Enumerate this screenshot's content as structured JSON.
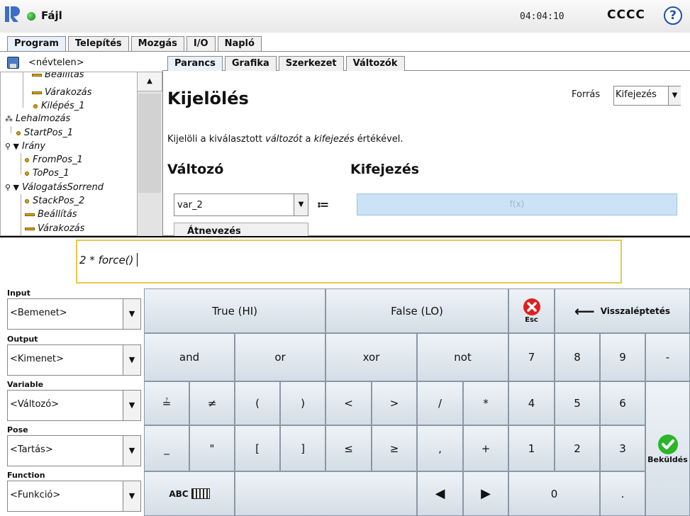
{
  "topbar": {
    "file_menu": "Fájl",
    "clock": "04:04:10",
    "robot_name": "CCCC",
    "help": "?"
  },
  "main_tabs": [
    "Program",
    "Telepítés",
    "Mozgás",
    "I/O",
    "Napló"
  ],
  "file": {
    "name": "<névtelen>"
  },
  "tree": [
    "Beállítás",
    "Várakozás",
    "Kilépés_1",
    "Lehalmozás",
    "StartPos_1",
    "Irány",
    "FromPos_1",
    "ToPos_1",
    "VálogatásSorrend",
    "StackPos_2",
    "Beállítás",
    "Várakozás"
  ],
  "sub_tabs": [
    "Parancs",
    "Grafika",
    "Szerkezet",
    "Változók"
  ],
  "panel": {
    "title": "Kijelölés",
    "source_label": "Forrás",
    "source_value": "Kifejezés",
    "desc_pre": "Kijelöli a kiválasztott ",
    "desc_var": "változót",
    "desc_mid": " a ",
    "desc_expr": "kifejezés",
    "desc_post": " értékével.",
    "var_heading": "Változó",
    "expr_heading": "Kifejezés",
    "var_value": "var_2",
    "assign_symbol": "≔",
    "expr_placeholder": "f(x)",
    "rename_label": "Átnevezés"
  },
  "editor": {
    "expression": "2 * force()",
    "dropdowns": [
      {
        "label": "Input",
        "value": "<Bemenet>"
      },
      {
        "label": "Output",
        "value": "<Kimenet>"
      },
      {
        "label": "Variable",
        "value": "<Változó>"
      },
      {
        "label": "Pose",
        "value": "<Tartás>"
      },
      {
        "label": "Function",
        "value": "<Funkció>"
      }
    ],
    "keys": {
      "true": "True (HI)",
      "false": "False (LO)",
      "esc": "Esc",
      "backspace": "Visszaléptetés",
      "and": "and",
      "or": "or",
      "xor": "xor",
      "not": "not",
      "eq": "≟",
      "neq": "≠",
      "lparen": "(",
      "rparen": ")",
      "lt": "<",
      "gt": ">",
      "div": "/",
      "mul": "*",
      "underscore": "_",
      "quote": "\"",
      "lbracket": "[",
      "rbracket": "]",
      "le": "≤",
      "ge": "≥",
      "comma": ",",
      "plus": "+",
      "abc": "ABC",
      "n7": "7",
      "n8": "8",
      "n9": "9",
      "minus": "-",
      "n4": "4",
      "n5": "5",
      "n6": "6",
      "n1": "1",
      "n2": "2",
      "n3": "3",
      "n0": "0",
      "dot": ".",
      "submit": "Beküldés"
    }
  },
  "colors": {
    "accent": "#2050b0",
    "expr_bg": "#cce3f7",
    "focus_border": "#e8c84a",
    "submit_green": "#2bb52b",
    "esc_red": "#e02020"
  }
}
